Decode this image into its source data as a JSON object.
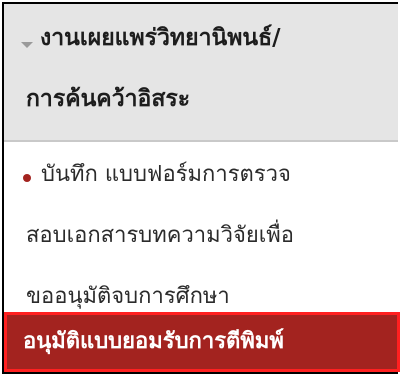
{
  "menu": {
    "section": {
      "title_line1": "งานเผยแพร่วิทยานิพนธ์/",
      "title_line2": "การค้นคว้าอิสระ",
      "expand_icon": "caret-down-icon"
    },
    "item": {
      "line1": "บันทึก แบบฟอร์มการตรวจ",
      "line2": "สอบเอกสารบทความวิจัยเพื่อ",
      "line3": "ขออนุมัติจบการศึกษา",
      "bullet_color": "#a3231f"
    },
    "active_item": {
      "label": "อนุมัติแบบยอมรับการตีพิมพ์",
      "background": "#a3231f",
      "highlight_border": "#ff2020"
    }
  }
}
